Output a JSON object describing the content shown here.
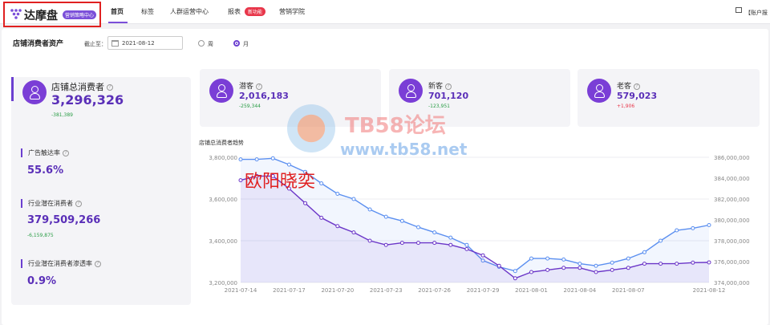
{
  "header": {
    "logo_text": "达摩盘",
    "logo_badge": "营销策略中心",
    "nav": [
      "首页",
      "标签",
      "人群运营中心",
      "报表",
      "营销学院"
    ],
    "nav_badge": "新功能",
    "account": "【账户报"
  },
  "panel": {
    "title": "店铺消费者资产",
    "date_label": "截止至：",
    "date_value": "2021-08-12",
    "radio_week": "周",
    "radio_month": "月",
    "selected_period": "月"
  },
  "summary": {
    "total_label": "店铺总消费者",
    "total_value": "3,296,326",
    "total_delta": "-381,389",
    "ad_reach_label": "广告触达率",
    "ad_reach_value": "55.6%",
    "industry_label": "行业潜在消费者",
    "industry_value": "379,509,266",
    "industry_delta": "-6,159,875",
    "penetration_label": "行业潜在消费者渗透率",
    "penetration_value": "0.9%"
  },
  "cards": [
    {
      "label": "潜客",
      "value": "2,016,183",
      "delta": "-259,344",
      "delta_color": "#2a9d46"
    },
    {
      "label": "新客",
      "value": "701,120",
      "delta": "-123,951",
      "delta_color": "#2a9d46"
    },
    {
      "label": "老客",
      "value": "579,023",
      "delta": "+1,906",
      "delta_color": "#e8364a"
    }
  ],
  "watermark": {
    "title": "TB58论坛",
    "url": "www.tb58.net",
    "name": "欧阳晓奕"
  },
  "colors": {
    "accent": "#6b3fd0",
    "blue_series": "#5b8ff0",
    "purple_series": "#6b36c8"
  },
  "chart_data": {
    "type": "line",
    "title": "店铺总消费者趋势",
    "x": [
      "2021-07-14",
      "2021-07-15",
      "2021-07-16",
      "2021-07-17",
      "2021-07-18",
      "2021-07-19",
      "2021-07-20",
      "2021-07-21",
      "2021-07-22",
      "2021-07-23",
      "2021-07-24",
      "2021-07-25",
      "2021-07-26",
      "2021-07-27",
      "2021-07-28",
      "2021-07-29",
      "2021-07-30",
      "2021-07-31",
      "2021-08-01",
      "2021-08-02",
      "2021-08-03",
      "2021-08-04",
      "2021-08-05",
      "2021-08-06",
      "2021-08-07",
      "2021-08-08",
      "2021-08-09",
      "2021-08-10",
      "2021-08-11",
      "2021-08-12"
    ],
    "x_ticks": [
      "2021-07-14",
      "2021-07-17",
      "2021-07-20",
      "2021-07-23",
      "2021-07-26",
      "2021-07-29",
      "2021-08-01",
      "2021-08-04",
      "2021-08-07",
      "2021-08-12"
    ],
    "y_left_ticks": [
      "3,200,000",
      "3,400,000",
      "3,600,000",
      "3,800,000"
    ],
    "y_left_range": [
      3200000,
      3800000
    ],
    "y_right_ticks": [
      "374,000,000",
      "376,000,000",
      "378,000,000",
      "380,000,000",
      "382,000,000",
      "384,000,000",
      "386,000,000"
    ],
    "y_right_range": [
      374000000,
      386000000
    ],
    "series": [
      {
        "axis": "right",
        "color": "#5b8ff0",
        "values": [
          385800000,
          385800000,
          385900000,
          385300000,
          384600000,
          383500000,
          382500000,
          382000000,
          381000000,
          380300000,
          379900000,
          379300000,
          378800000,
          378300000,
          377600000,
          376100000,
          375500000,
          375100000,
          376300000,
          376300000,
          376200000,
          375800000,
          375600000,
          375900000,
          376300000,
          376900000,
          378000000,
          379000000,
          379200000,
          379500000
        ]
      },
      {
        "axis": "left",
        "color": "#6b36c8",
        "values": [
          3690000,
          3710000,
          3710000,
          3650000,
          3580000,
          3510000,
          3470000,
          3440000,
          3400000,
          3380000,
          3390000,
          3390000,
          3390000,
          3380000,
          3360000,
          3330000,
          3280000,
          3220000,
          3250000,
          3260000,
          3270000,
          3270000,
          3250000,
          3260000,
          3270000,
          3290000,
          3290000,
          3290000,
          3295000,
          3296326
        ]
      }
    ]
  }
}
